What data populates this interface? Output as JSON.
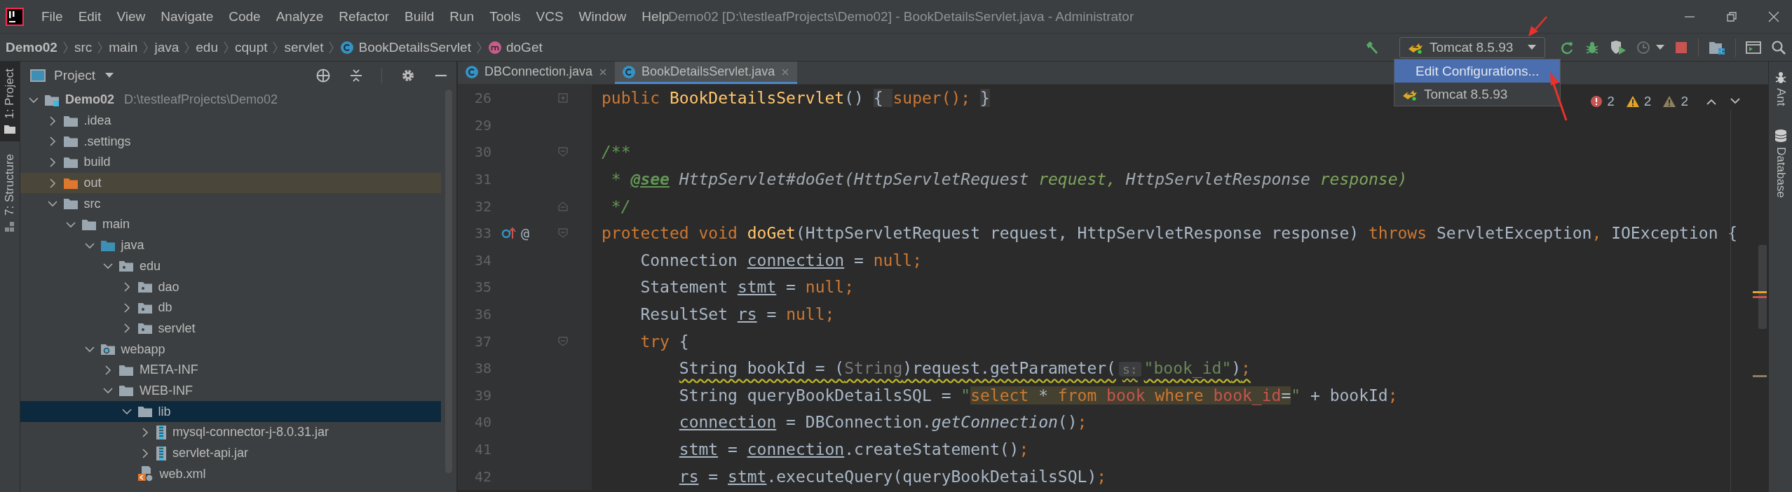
{
  "window": {
    "title": "Demo02 [D:\\testleafProjects\\Demo02] - BookDetailsServlet.java - Administrator"
  },
  "menu": [
    {
      "label": "File"
    },
    {
      "label": "Edit"
    },
    {
      "label": "View"
    },
    {
      "label": "Navigate"
    },
    {
      "label": "Code"
    },
    {
      "label": "Analyze"
    },
    {
      "label": "Refactor"
    },
    {
      "label": "Build"
    },
    {
      "label": "Run"
    },
    {
      "label": "Tools"
    },
    {
      "label": "VCS"
    },
    {
      "label": "Window"
    },
    {
      "label": "Help"
    }
  ],
  "breadcrumbs": [
    {
      "label": "Demo02",
      "kind": "project"
    },
    {
      "label": "src",
      "kind": "folder"
    },
    {
      "label": "main",
      "kind": "folder"
    },
    {
      "label": "java",
      "kind": "folder"
    },
    {
      "label": "edu",
      "kind": "folder"
    },
    {
      "label": "cqupt",
      "kind": "folder"
    },
    {
      "label": "servlet",
      "kind": "folder"
    },
    {
      "label": "BookDetailsServlet",
      "kind": "class"
    },
    {
      "label": "doGet",
      "kind": "method"
    }
  ],
  "toolbar": {
    "run_config": {
      "label": "Tomcat 8.5.93",
      "menu": [
        {
          "label": "Edit Configurations...",
          "kind": "action",
          "selected": true
        },
        {
          "label": "Tomcat 8.5.93",
          "kind": "tomcat",
          "selected": false
        }
      ]
    }
  },
  "left_tool_tabs": [
    {
      "label": "1: Project",
      "kind": "project",
      "selected": true
    },
    {
      "label": "7: Structure",
      "kind": "structure",
      "selected": false
    }
  ],
  "right_tool_tabs": [
    {
      "label": "Ant",
      "kind": "ant"
    },
    {
      "label": "Database",
      "kind": "database"
    }
  ],
  "project": {
    "title": "Project",
    "tree": [
      {
        "label": "Demo02",
        "path": "D:\\testleafProjects\\Demo02",
        "kind": "module",
        "expanded": true,
        "selected": false,
        "children": [
          {
            "label": ".idea",
            "kind": "folder",
            "expanded": false,
            "selected": false
          },
          {
            "label": ".settings",
            "kind": "folder",
            "expanded": false,
            "selected": false
          },
          {
            "label": "build",
            "kind": "folder",
            "expanded": false,
            "selected": false
          },
          {
            "label": "out",
            "kind": "excluded",
            "expanded": false,
            "selected": false
          },
          {
            "label": "src",
            "kind": "folder",
            "expanded": true,
            "selected": false,
            "children": [
              {
                "label": "main",
                "kind": "folder",
                "expanded": true,
                "selected": false,
                "children": [
                  {
                    "label": "java",
                    "kind": "source",
                    "expanded": true,
                    "selected": false,
                    "children": [
                      {
                        "label": "edu",
                        "kind": "package",
                        "expanded": true,
                        "selected": false,
                        "children": [
                          {
                            "label": "dao",
                            "kind": "package",
                            "expanded": false,
                            "selected": false
                          },
                          {
                            "label": "db",
                            "kind": "package",
                            "expanded": false,
                            "selected": false
                          },
                          {
                            "label": "servlet",
                            "kind": "package",
                            "expanded": false,
                            "selected": false
                          }
                        ]
                      }
                    ]
                  },
                  {
                    "label": "webapp",
                    "kind": "web",
                    "expanded": true,
                    "selected": false,
                    "children": [
                      {
                        "label": "META-INF",
                        "kind": "folder",
                        "expanded": false,
                        "selected": false
                      },
                      {
                        "label": "WEB-INF",
                        "kind": "folder",
                        "expanded": true,
                        "selected": false,
                        "children": [
                          {
                            "label": "lib",
                            "kind": "folder",
                            "expanded": true,
                            "selected": true,
                            "children": [
                              {
                                "label": "mysql-connector-j-8.0.31.jar",
                                "kind": "jar",
                                "expanded": false,
                                "selected": false
                              },
                              {
                                "label": "servlet-api.jar",
                                "kind": "jar",
                                "expanded": false,
                                "selected": false
                              }
                            ]
                          },
                          {
                            "label": "web.xml",
                            "kind": "xml",
                            "selected": false
                          }
                        ]
                      }
                    ]
                  }
                ]
              }
            ]
          }
        ]
      }
    ]
  },
  "editor": {
    "tabs": [
      {
        "label": "DBConnection.java",
        "selected": false
      },
      {
        "label": "BookDetailsServlet.java",
        "selected": true
      }
    ],
    "inspections": {
      "errors": "2",
      "warnings": "2",
      "weak_warnings": "2"
    },
    "lines": [
      {
        "number": "26",
        "fold_marker": {
          "kind": "plus"
        },
        "overrides": false,
        "warning": false,
        "tokens": [
          {
            "kind": "kw",
            "text": "public "
          },
          {
            "kind": "decl",
            "text": "BookDetailsServlet"
          },
          {
            "kind": "plain",
            "text": "() "
          },
          {
            "kind": "fold",
            "text": "{ "
          },
          {
            "kind": "kw",
            "text": "super(); "
          },
          {
            "kind": "fold",
            "text": "}"
          }
        ]
      },
      {
        "number": "29",
        "overrides": false,
        "warning": false
      },
      {
        "number": "30",
        "fold_marker": {
          "kind": "open"
        },
        "overrides": false,
        "warning": false,
        "tokens": [
          {
            "kind": "doc",
            "text": "/**"
          }
        ]
      },
      {
        "number": "31",
        "overrides": false,
        "warning": false,
        "tokens": [
          {
            "kind": "doc",
            "text": " * "
          },
          {
            "kind": "doctag",
            "text": "@see"
          },
          {
            "kind": "docref",
            "text": " HttpServlet#doGet(HttpServletRequest"
          },
          {
            "kind": "docparam",
            "text": " request, "
          },
          {
            "kind": "docref",
            "text": "HttpServletResponse"
          },
          {
            "kind": "docparam",
            "text": " response)"
          }
        ]
      },
      {
        "number": "32",
        "fold_marker": {
          "kind": "close"
        },
        "overrides": false,
        "warning": false,
        "tokens": [
          {
            "kind": "doc",
            "text": " */"
          }
        ]
      },
      {
        "number": "33",
        "fold_marker": {
          "kind": "open"
        },
        "overrides": true,
        "annotation": "@",
        "warning": false,
        "tokens": [
          {
            "kind": "kw",
            "text": "protected void "
          },
          {
            "kind": "decl",
            "text": "doGet"
          },
          {
            "kind": "plain",
            "text": "(HttpServletRequest request, HttpServletResponse response) "
          },
          {
            "kind": "kw",
            "text": "throws "
          },
          {
            "kind": "plain",
            "text": "ServletException"
          },
          {
            "kind": "kw",
            "text": ", "
          },
          {
            "kind": "plain",
            "text": "IOException {"
          }
        ]
      },
      {
        "number": "34",
        "overrides": false,
        "warning": false,
        "tokens": [
          {
            "kind": "plain",
            "text": "    Connection "
          },
          {
            "kind": "var",
            "text": "connection"
          },
          {
            "kind": "plain",
            "text": " = "
          },
          {
            "kind": "kw",
            "text": "null;"
          }
        ]
      },
      {
        "number": "35",
        "overrides": false,
        "warning": false,
        "tokens": [
          {
            "kind": "plain",
            "text": "    Statement "
          },
          {
            "kind": "var",
            "text": "stmt"
          },
          {
            "kind": "plain",
            "text": " = "
          },
          {
            "kind": "kw",
            "text": "null;"
          }
        ]
      },
      {
        "number": "36",
        "overrides": false,
        "warning": false,
        "tokens": [
          {
            "kind": "plain",
            "text": "    ResultSet "
          },
          {
            "kind": "var",
            "text": "rs"
          },
          {
            "kind": "plain",
            "text": " = "
          },
          {
            "kind": "kw",
            "text": "null;"
          }
        ]
      },
      {
        "number": "37",
        "fold_marker": {
          "kind": "open"
        },
        "overrides": false,
        "warning": false,
        "tokens": [
          {
            "kind": "kw",
            "text": "    try"
          },
          {
            "kind": "plain",
            "text": " {"
          }
        ]
      },
      {
        "number": "38",
        "overrides": false,
        "warning": true,
        "tokens": [
          {
            "kind": "plain",
            "text": "        String bookId = ("
          },
          {
            "kind": "cast",
            "text": "String"
          },
          {
            "kind": "plain",
            "text": ")request.getParameter("
          },
          {
            "kind": "hint",
            "text": "s:"
          },
          {
            "kind": "str",
            "text": "\"book_id\""
          },
          {
            "kind": "plain",
            "text": ")"
          },
          {
            "kind": "kw",
            "text": ";"
          }
        ]
      },
      {
        "number": "39",
        "overrides": false,
        "warning": false,
        "tokens": [
          {
            "kind": "plain",
            "text": "        String queryBookDetailsSQL = "
          },
          {
            "kind": "str",
            "text": "\""
          },
          {
            "kind": "sql-kw",
            "text": "select "
          },
          {
            "kind": "sql-op",
            "text": "* "
          },
          {
            "kind": "sql-kw",
            "text": "from "
          },
          {
            "kind": "sql-id",
            "text": "book"
          },
          {
            "kind": "sql-kw",
            "text": " where "
          },
          {
            "kind": "sql-id",
            "text": "book_id"
          },
          {
            "kind": "sql-op",
            "text": "="
          },
          {
            "kind": "str",
            "text": "\""
          },
          {
            "kind": "plain",
            "text": " + bookId"
          },
          {
            "kind": "kw",
            "text": ";"
          }
        ]
      },
      {
        "number": "40",
        "overrides": false,
        "warning": false,
        "tokens": [
          {
            "kind": "var",
            "text": "        connection"
          },
          {
            "kind": "plain",
            "text": " = DBConnection."
          },
          {
            "kind": "static",
            "text": "getConnection"
          },
          {
            "kind": "plain",
            "text": "()"
          },
          {
            "kind": "kw",
            "text": ";"
          }
        ]
      },
      {
        "number": "41",
        "overrides": false,
        "warning": false,
        "tokens": [
          {
            "kind": "var",
            "text": "        stmt"
          },
          {
            "kind": "plain",
            "text": " = "
          },
          {
            "kind": "var",
            "text": "connection"
          },
          {
            "kind": "plain",
            "text": ".createStatement()"
          },
          {
            "kind": "kw",
            "text": ";"
          }
        ]
      },
      {
        "number": "42",
        "overrides": false,
        "warning": false,
        "tokens": [
          {
            "kind": "var",
            "text": "        rs"
          },
          {
            "kind": "plain",
            "text": " = "
          },
          {
            "kind": "var",
            "text": "stmt"
          },
          {
            "kind": "plain",
            "text": ".executeQuery(queryBookDetailsSQL)"
          },
          {
            "kind": "kw",
            "text": ";"
          }
        ]
      }
    ]
  }
}
